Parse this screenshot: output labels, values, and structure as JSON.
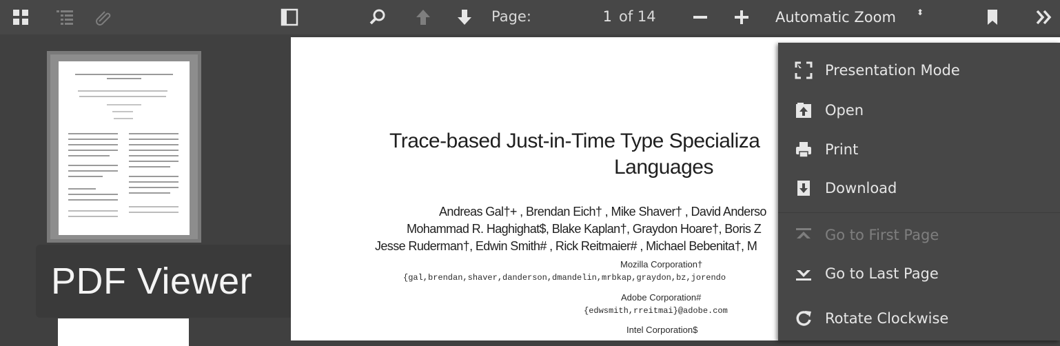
{
  "toolbar": {
    "page_label": "Page:",
    "page_value": "1",
    "page_of": "of 14",
    "zoom_value": "Automatic Zoom",
    "zoom_arrow": "⬍",
    "icons": [
      "thumbnails-icon",
      "outline-icon",
      "attachments-icon",
      "sidebar-toggle-icon",
      "search-icon",
      "previous-page-icon",
      "next-page-icon",
      "zoom-out-icon",
      "zoom-in-icon",
      "bookmark-icon",
      "tools-icon"
    ]
  },
  "badge": {
    "text": "PDF Viewer"
  },
  "document": {
    "title_line1": "Trace-based Just-in-Time Type Specializa",
    "title_line2": "Languages",
    "authors_line1": "Andreas Gal†+ , Brendan Eich† , Mike Shaver† , David Anderso",
    "authors_line2": "Mohammad R. Haghighat$, Blake Kaplan†, Graydon Hoare†, Boris Z",
    "authors_line3": "Jesse Ruderman†, Edwin Smith# , Rick Reitmaier# , Michael Bebenita†, M",
    "aff1": "Mozilla Corporation†",
    "aff1_emails": "{gal,brendan,shaver,danderson,dmandelin,mrbkap,graydon,bz,jorendo",
    "aff2": "Adobe Corporation#",
    "aff2_emails": "{edwsmith,rreitmai}@adobe.com",
    "aff3": "Intel Corporation$"
  },
  "menu": {
    "items": [
      {
        "label": "Presentation Mode",
        "icon": "presentation-mode-icon",
        "enabled": true
      },
      {
        "label": "Open",
        "icon": "open-file-icon",
        "enabled": true
      },
      {
        "label": "Print",
        "icon": "print-icon",
        "enabled": true
      },
      {
        "label": "Download",
        "icon": "download-icon",
        "enabled": true
      },
      {
        "label": "Go to First Page",
        "icon": "first-page-icon",
        "enabled": false
      },
      {
        "label": "Go to Last Page",
        "icon": "last-page-icon",
        "enabled": true
      },
      {
        "label": "Rotate Clockwise",
        "icon": "rotate-clockwise-icon",
        "enabled": true
      }
    ]
  },
  "colors": {
    "toolbar": "#474747",
    "background": "#404040",
    "menu": "#474747",
    "text": "#e6e6e6"
  }
}
